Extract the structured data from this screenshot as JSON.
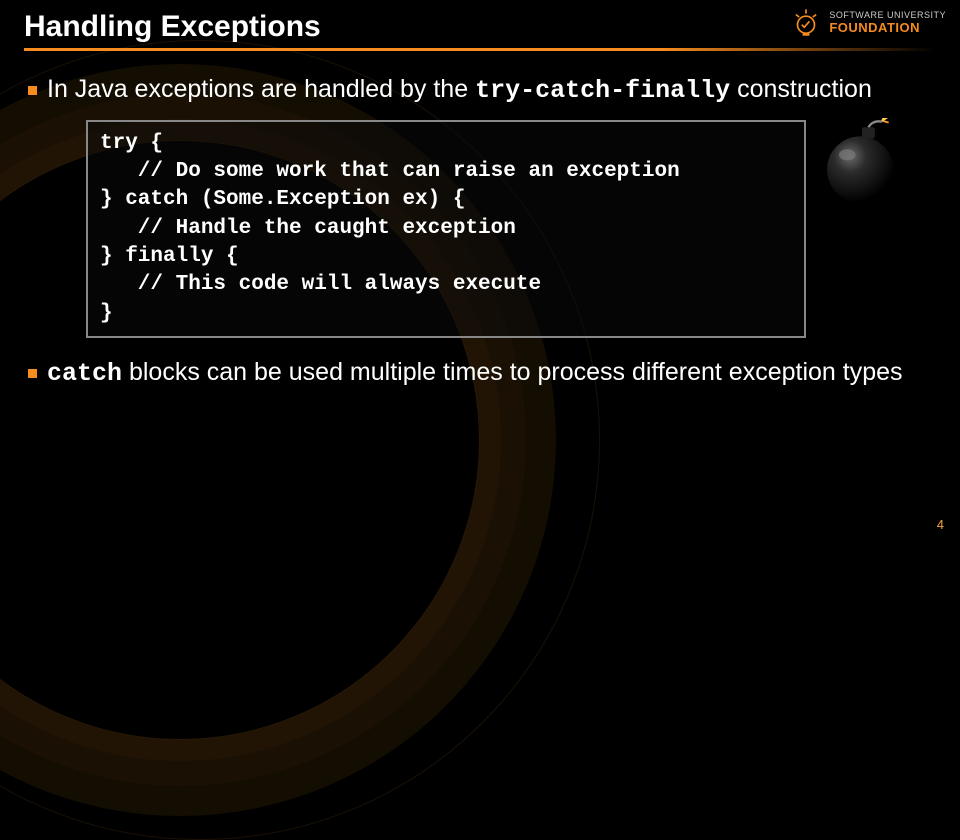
{
  "colors": {
    "accent": "#f68b1e"
  },
  "logo": {
    "line1": "SOFTWARE UNIVERSITY",
    "line2": "FOUNDATION"
  },
  "title": "Handling Exceptions",
  "bullets": [
    {
      "pre": "In Java exceptions are handled by the ",
      "code": "try-catch-finally",
      "post": " construction"
    },
    {
      "code": "catch",
      "post": " blocks can be used multiple times to process different exception types"
    }
  ],
  "code": "try {\n   // Do some work that can raise an exception\n} catch (Some.Exception ex) {\n   // Handle the caught exception\n} finally {\n   // This code will always execute\n}",
  "icons": {
    "bomb": "bomb-icon"
  },
  "page_number": "4"
}
